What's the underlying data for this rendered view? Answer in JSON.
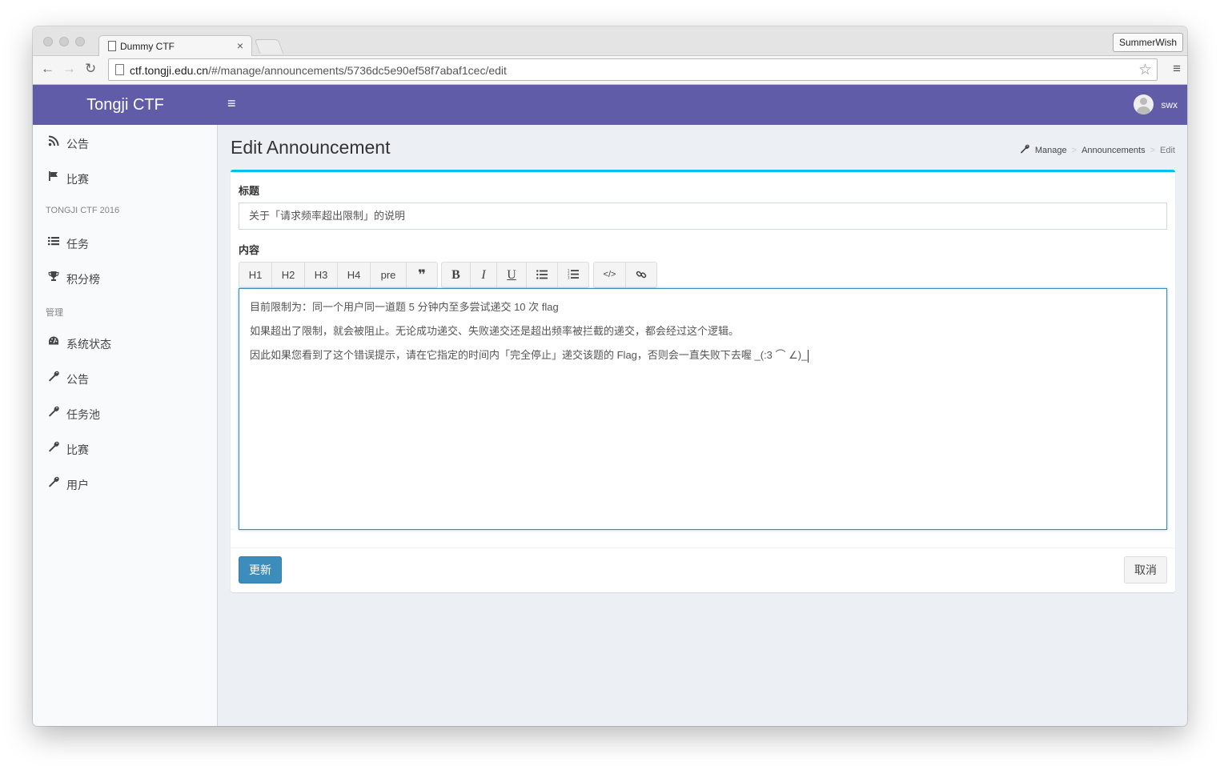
{
  "browser": {
    "tab_title": "Dummy CTF",
    "tab_close": "×",
    "profile_name": "SummerWish",
    "url_host": "ctf.tongji.edu.cn",
    "url_path": "/#/manage/announcements/5736dc5e90ef58f7abaf1cec/edit",
    "icons": {
      "back": "←",
      "forward": "→",
      "reload": "↻",
      "star": "☆",
      "menu": "≡"
    }
  },
  "header": {
    "brand": "Tongji CTF",
    "toggle_icon": "≡",
    "username": "swx",
    "bg_color": "#605ca8"
  },
  "sidebar": {
    "items_top": [
      {
        "label": "公告",
        "icon": "rss-icon",
        "glyph": "⌇"
      },
      {
        "label": "比赛",
        "icon": "flag-icon",
        "glyph": "⚑"
      }
    ],
    "section_contest": "TONGJI CTF 2016",
    "items_contest": [
      {
        "label": "任务",
        "icon": "list-icon",
        "glyph": "☰"
      },
      {
        "label": "积分榜",
        "icon": "trophy-icon",
        "glyph": "🏆"
      }
    ],
    "section_manage": "管理",
    "items_manage": [
      {
        "label": "系统状态",
        "icon": "dashboard-icon",
        "glyph": "◕"
      },
      {
        "label": "公告",
        "icon": "wrench-icon",
        "glyph": "🔧"
      },
      {
        "label": "任务池",
        "icon": "wrench-icon",
        "glyph": "🔧"
      },
      {
        "label": "比赛",
        "icon": "wrench-icon",
        "glyph": "🔧"
      },
      {
        "label": "用户",
        "icon": "wrench-icon",
        "glyph": "🔧"
      }
    ]
  },
  "page": {
    "title": "Edit Announcement",
    "breadcrumb": [
      "Manage",
      "Announcements",
      "Edit"
    ],
    "breadcrumb_sep": ">"
  },
  "form": {
    "title_label": "标题",
    "title_value": "关于「请求频率超出限制」的说明",
    "content_label": "内容",
    "toolbar": {
      "h1": "H1",
      "h2": "H2",
      "h3": "H3",
      "h4": "H4",
      "pre": "pre",
      "quote": "❞",
      "bold": "B",
      "italic": "I",
      "underline": "U",
      "ul": "☰",
      "ol": "☷",
      "code": "</>",
      "link": "🔗"
    },
    "content_lines": [
      "目前限制为：同一个用户同一道题 5 分钟内至多尝试递交 10 次 flag",
      "如果超出了限制，就会被阻止。无论成功递交、失败递交还是超出频率被拦截的递交，都会经过这个逻辑。",
      "因此如果您看到了这个错误提示，请在它指定的时间内「完全停止」递交该题的 Flag，否则会一直失败下去喔 _(:3 ⌒ ∠)_"
    ],
    "submit_label": "更新",
    "cancel_label": "取消",
    "accent_color": "#00c0ef",
    "primary_color": "#3c8dbc"
  }
}
